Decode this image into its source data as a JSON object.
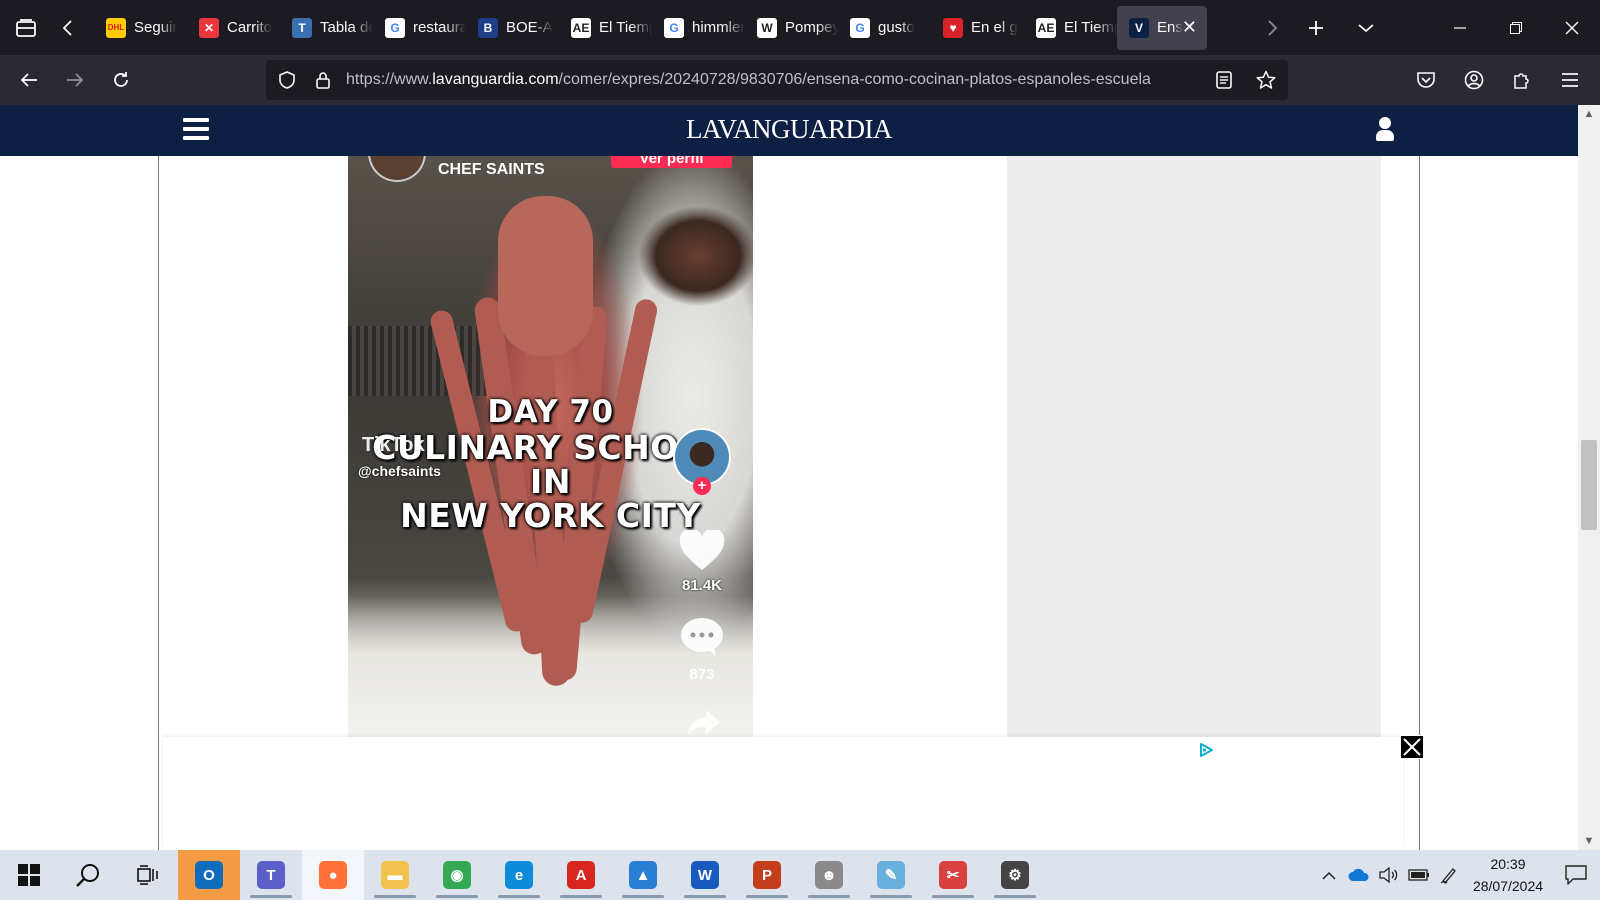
{
  "browser": {
    "tabs": [
      {
        "title": "Seguir",
        "icon": "dhl-icon",
        "color": "#ffcc00",
        "glyph": "DHL"
      },
      {
        "title": "Carrito",
        "icon": "x-red-icon",
        "color": "#e8383d",
        "glyph": "✕"
      },
      {
        "title": "Tabla de",
        "icon": "tabla-icon",
        "color": "#3a6fb0",
        "glyph": "T"
      },
      {
        "title": "restaurante",
        "icon": "google-icon",
        "color": "#ffffff",
        "glyph": "G"
      },
      {
        "title": "BOE-A",
        "icon": "boe-icon",
        "color": "#1f3e8a",
        "glyph": "B"
      },
      {
        "title": "El Tiempo",
        "icon": "aemet-icon",
        "color": "#ffffff",
        "glyph": "AE"
      },
      {
        "title": "himmler",
        "icon": "google-icon",
        "color": "#ffffff",
        "glyph": "G"
      },
      {
        "title": "Pompeya",
        "icon": "wikipedia-icon",
        "color": "#ffffff",
        "glyph": "W"
      },
      {
        "title": "gusto",
        "icon": "google-icon",
        "color": "#ffffff",
        "glyph": "G"
      },
      {
        "title": "En el g",
        "icon": "heart-red-icon",
        "color": "#d8232a",
        "glyph": "♥"
      },
      {
        "title": "El Tiempo",
        "icon": "aemet-icon",
        "color": "#ffffff",
        "glyph": "AE"
      },
      {
        "title": "Ens",
        "icon": "vanguardia-v-icon",
        "color": "#0e1f44",
        "glyph": "V",
        "active": true
      }
    ],
    "url_prefix": "https://www.",
    "url_host": "lavanguardia.com",
    "url_path": "/comer/expres/20240728/9830706/ensena-como-cocinan-platos-espanoles-escuela"
  },
  "site": {
    "logo": "LAVANGUARDIA"
  },
  "video": {
    "author_name": "CHEF SAINTS",
    "follow_label": "Ver perfil",
    "overlay_line1": "DAY 70",
    "overlay_line2": "CULINARY SCHOOL",
    "overlay_line3": "IN",
    "overlay_line4": "NEW YORK CITY",
    "tiktok_logo": "TikTok",
    "handle": "@chefsaints",
    "likes": "81.4K",
    "comments": "873"
  },
  "taskbar": {
    "apps": [
      {
        "name": "outlook-icon",
        "glyph": "O",
        "color": "#0f6cbd",
        "state": "outlook-on"
      },
      {
        "name": "teams-icon",
        "glyph": "T",
        "color": "#5b5fc7",
        "state": "running"
      },
      {
        "name": "firefox-icon",
        "glyph": "●",
        "color": "#ff7139",
        "state": "focused"
      },
      {
        "name": "file-explorer-icon",
        "glyph": "▬",
        "color": "#f2c14e",
        "state": "running"
      },
      {
        "name": "chrome-icon",
        "glyph": "◉",
        "color": "#34a853",
        "state": "running"
      },
      {
        "name": "edge-icon",
        "glyph": "e",
        "color": "#0c8cd8",
        "state": "running"
      },
      {
        "name": "acrobat-icon",
        "glyph": "A",
        "color": "#d7261e",
        "state": "running"
      },
      {
        "name": "photos-icon",
        "glyph": "▲",
        "color": "#2a7fd4",
        "state": "running"
      },
      {
        "name": "word-icon",
        "glyph": "W",
        "color": "#185abd",
        "state": "running"
      },
      {
        "name": "powerpoint-icon",
        "glyph": "P",
        "color": "#c43e1c",
        "state": "running"
      },
      {
        "name": "game-icon",
        "glyph": "☻",
        "color": "#8a8a8a",
        "state": "running"
      },
      {
        "name": "paint-icon",
        "glyph": "✎",
        "color": "#6ab0de",
        "state": "running"
      },
      {
        "name": "snipping-tool-icon",
        "glyph": "✂",
        "color": "#d94040",
        "state": "running"
      },
      {
        "name": "settings-icon",
        "glyph": "⚙",
        "color": "#444444",
        "state": "running"
      }
    ],
    "time": "20:39",
    "date": "28/07/2024"
  }
}
